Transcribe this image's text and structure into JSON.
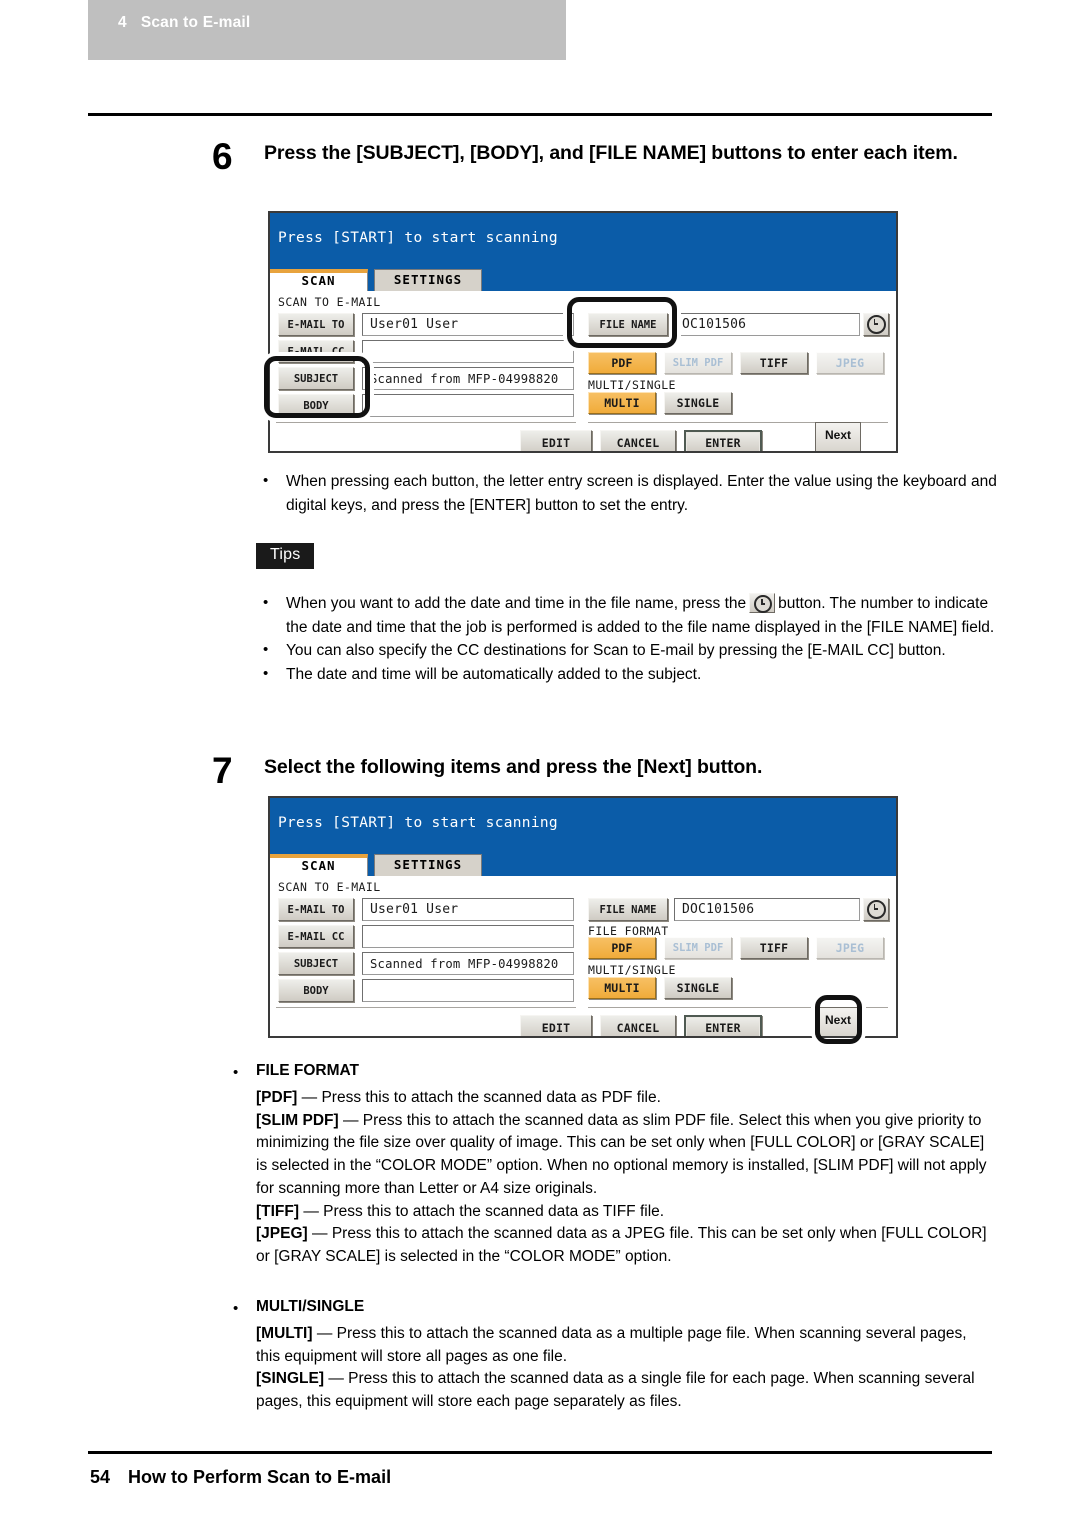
{
  "header": {
    "chapter_number": "4",
    "chapter_title": "Scan to E-mail"
  },
  "steps": [
    {
      "number": "6",
      "title": "Press the [SUBJECT], [BODY], and [FILE NAME] buttons to enter each item."
    },
    {
      "number": "7",
      "title": "Select the following items and press the [Next] button."
    }
  ],
  "lcd": {
    "status_message": "Press [START] to start scanning",
    "tabs": {
      "scan": "SCAN",
      "settings": "SETTINGS"
    },
    "section_label": "SCAN TO E-MAIL",
    "left_buttons": {
      "email_to": "E-MAIL TO",
      "email_cc": "E-MAIL CC",
      "subject": "SUBJECT",
      "body": "BODY"
    },
    "left_fields": {
      "email_to_value": "User01 User",
      "email_cc_value": "",
      "subject_value": "Scanned from MFP-04998820",
      "body_value": ""
    },
    "file_name_button": "FILE NAME",
    "file_name_value": "DOC101506",
    "file_name_value_clipped": "OC101506",
    "clock_icon": "clock-icon",
    "file_format_label": "FILE FORMAT",
    "file_format_buttons": [
      {
        "label": "PDF",
        "state": "selected"
      },
      {
        "label": "SLIM PDF",
        "state": "disabled"
      },
      {
        "label": "TIFF",
        "state": "normal"
      },
      {
        "label": "JPEG",
        "state": "disabled"
      }
    ],
    "multi_single_label": "MULTI/SINGLE",
    "multi_single_buttons": [
      {
        "label": "MULTI",
        "state": "selected"
      },
      {
        "label": "SINGLE",
        "state": "normal"
      }
    ],
    "bottom_buttons": {
      "edit": "EDIT",
      "cancel": "CANCEL",
      "enter": "ENTER",
      "next": "Next"
    }
  },
  "note_step6": {
    "bullet": "•",
    "text": "When pressing each button, the letter entry screen is displayed.  Enter the value using the keyboard and digital keys, and press the [ENTER] button to set the entry."
  },
  "tips": {
    "tag": "Tips",
    "items": [
      {
        "bullet": "•",
        "text_before": "When you want to add the date and time in the file name, press the",
        "icon": "clock-icon",
        "text_after": "button.   The number to indicate the date and time that the job is performed is added to the file name displayed in the [FILE NAME] field."
      },
      {
        "bullet": "•",
        "text": "You can also specify the CC destinations for Scan to E-mail by pressing the [E-MAIL CC] button."
      },
      {
        "bullet": "•",
        "text": "The date and time will be automatically added to the subject."
      }
    ]
  },
  "descriptions": [
    {
      "bullet": "•",
      "heading": "FILE FORMAT",
      "paragraphs": [
        {
          "term": "[PDF]",
          "dash": " — ",
          "body": "Press this to attach the scanned data as PDF file."
        },
        {
          "term": "[SLIM PDF]",
          "dash": " — ",
          "body": "Press this to attach the scanned data as slim PDF file.  Select this when you give priority to minimizing the file size over quality of image.  This can be set only when [FULL COLOR] or [GRAY SCALE] is selected in the “COLOR MODE” option.  When no optional memory is installed, [SLIM PDF] will not apply for scanning more than Letter or A4 size originals."
        },
        {
          "term": "[TIFF]",
          "dash": " — ",
          "body": "Press this to attach the scanned data as TIFF file."
        },
        {
          "term": "[JPEG]",
          "dash": " — ",
          "body": "Press this to attach the scanned data as a JPEG file.  This can be set only when [FULL COLOR] or [GRAY SCALE] is selected in the “COLOR MODE” option."
        }
      ]
    },
    {
      "bullet": "•",
      "heading": "MULTI/SINGLE",
      "paragraphs": [
        {
          "term": "[MULTI]",
          "dash": " — ",
          "body": "Press this to attach the scanned data as a multiple page file.  When scanning several pages, this equipment will store all pages as one file."
        },
        {
          "term": "[SINGLE]",
          "dash": " — ",
          "body": "Press this to attach the scanned data as a single file for each page.  When scanning several pages, this equipment will store each page separately as files."
        }
      ]
    }
  ],
  "footer": {
    "page_number": "54",
    "section_title": "How to Perform Scan to E-mail"
  }
}
